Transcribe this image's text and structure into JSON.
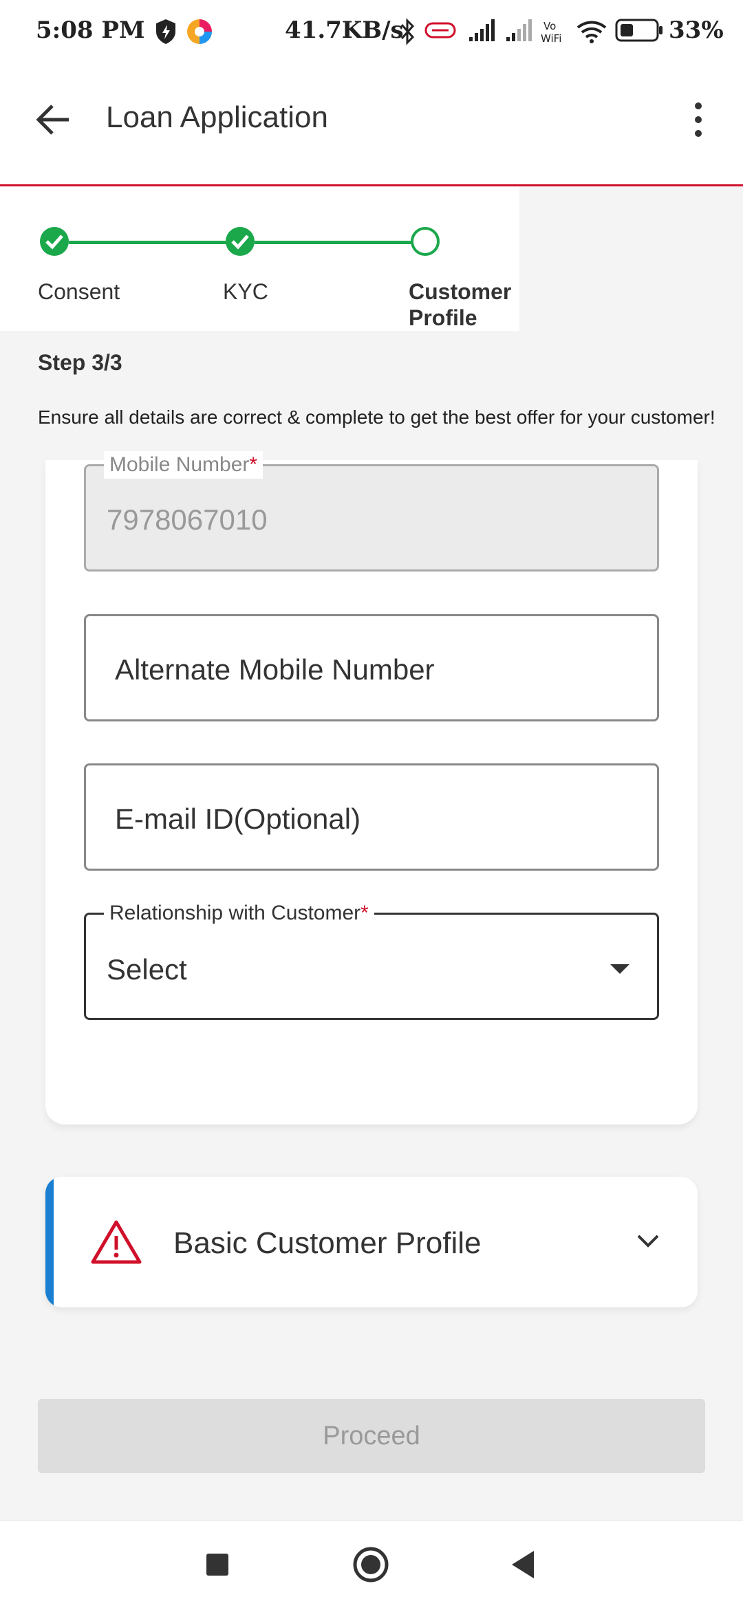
{
  "status_bar": {
    "time": "5:08 PM",
    "net_speed": "41.7KB/s",
    "battery_percent": "33%"
  },
  "app_bar": {
    "title": "Loan Application"
  },
  "stepper": {
    "steps": [
      {
        "label": "Consent",
        "state": "completed"
      },
      {
        "label": "KYC",
        "state": "completed"
      },
      {
        "label_line1": "Customer",
        "label_line2": "Profile",
        "state": "current"
      }
    ],
    "completed_color": "#1aa84a"
  },
  "info": {
    "step_count": "Step 3/3",
    "hint": "Ensure all details are correct & complete to get the best offer for your customer!"
  },
  "form": {
    "mobile": {
      "label": "Mobile Number",
      "required_mark": "*",
      "value": "7978067010"
    },
    "alternate_mobile": {
      "placeholder": "Alternate Mobile Number"
    },
    "email": {
      "placeholder": "E-mail ID(Optional)"
    },
    "relationship": {
      "label": "Relationship with Customer",
      "required_mark": "*",
      "value": "Select"
    }
  },
  "profile_section": {
    "label": "Basic Customer Profile",
    "accent_color": "#1a7fd0",
    "warning_color": "#d0102a"
  },
  "actions": {
    "proceed_label": "Proceed"
  },
  "theme": {
    "brand_red": "#d0102a"
  }
}
